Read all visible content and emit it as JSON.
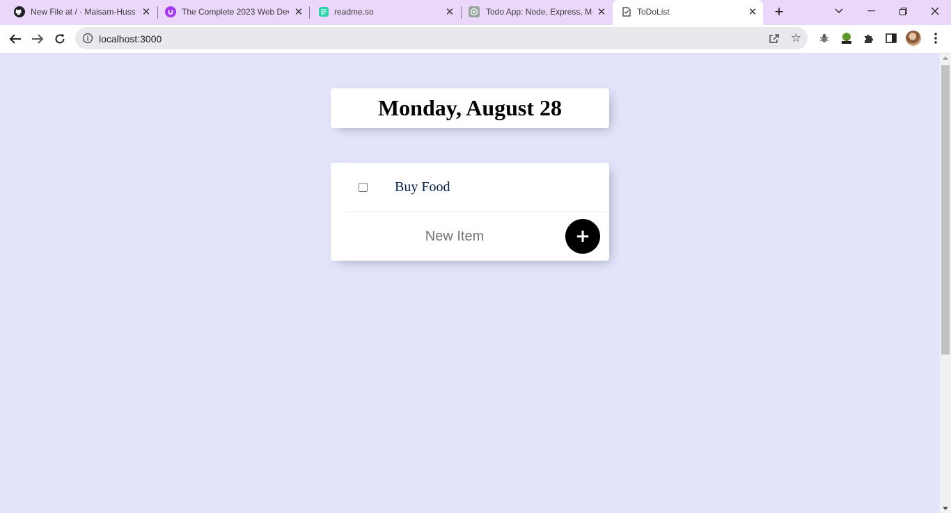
{
  "browser": {
    "tabs": [
      {
        "title": "New File at / · Maisam-Hussa",
        "favicon": "github-icon"
      },
      {
        "title": "The Complete 2023 Web Dev",
        "favicon": "udemy-icon"
      },
      {
        "title": "readme.so",
        "favicon": "readme-icon"
      },
      {
        "title": "Todo App: Node, Express, Mo",
        "favicon": "chatgpt-icon"
      },
      {
        "title": "ToDoList",
        "favicon": "todolist-icon",
        "active": true
      }
    ],
    "new_tab_label": "+",
    "url": "localhost:3000"
  },
  "app": {
    "heading": "Monday, August 28",
    "items": [
      {
        "text": "Buy Food",
        "checked": false
      }
    ],
    "new_item_placeholder": "New Item",
    "add_button_label": "+"
  },
  "colors": {
    "page_background": "#e1e4fb",
    "tabstrip_background": "#ebd7fa",
    "item_text": "#00204a",
    "add_button": "#000000"
  }
}
